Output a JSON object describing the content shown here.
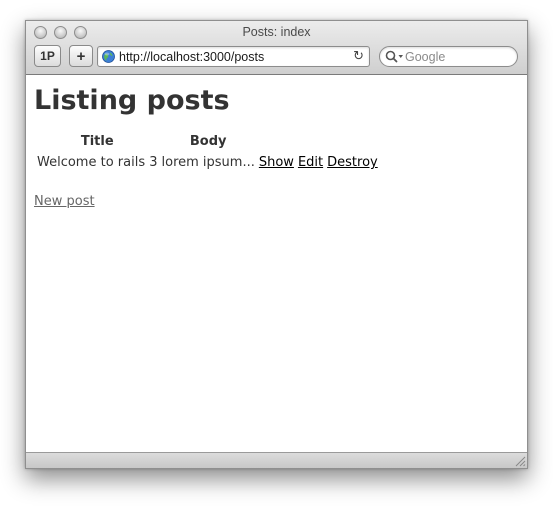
{
  "window": {
    "title": "Posts: index"
  },
  "toolbar": {
    "onepassword_label": "1P",
    "add_label": "+",
    "url": "http://localhost:3000/posts",
    "reload_glyph": "↻",
    "search_placeholder": "Google"
  },
  "page": {
    "heading": "Listing posts",
    "table": {
      "columns": [
        "Title",
        "Body"
      ],
      "rows": [
        {
          "title": "Welcome to rails 3",
          "body": "lorem ipsum...",
          "actions": [
            "Show",
            "Edit",
            "Destroy"
          ]
        }
      ]
    },
    "new_post_link": "New post"
  },
  "icons": {
    "close": "traffic-light-close-icon",
    "minimize": "traffic-light-minimize-icon",
    "zoom": "traffic-light-zoom-icon",
    "globe": "globe-icon",
    "reload": "reload-icon",
    "search": "search-icon",
    "resize": "resize-grip-icon"
  },
  "colors": {
    "text": "#333333",
    "link": "#000000",
    "muted_link": "#666666"
  }
}
